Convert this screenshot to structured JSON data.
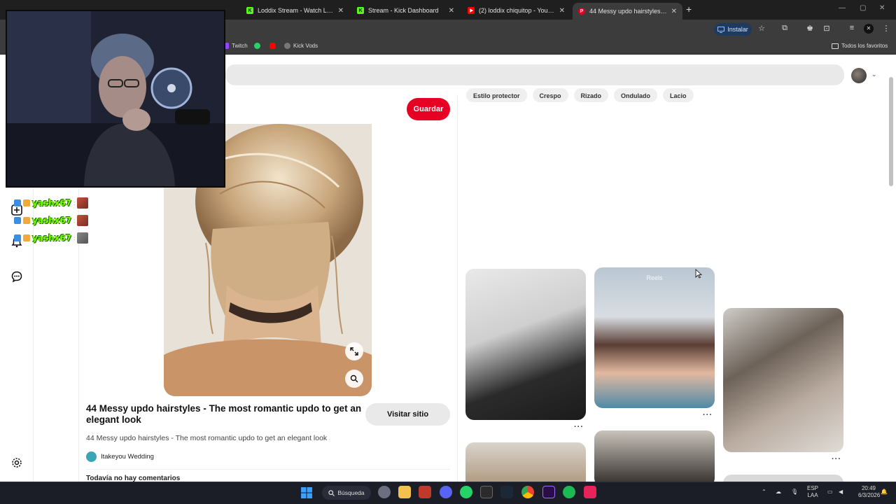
{
  "browser": {
    "tabs": [
      {
        "title": "Loddix Stream - Watch Live on",
        "icon": "kick-icon",
        "color": "#53fc18"
      },
      {
        "title": "Stream - Kick Dashboard",
        "icon": "kick-icon",
        "color": "#53fc18"
      },
      {
        "title": "(2) loddix chiquitop - YouTube",
        "icon": "youtube-icon",
        "color": "#ff0000"
      },
      {
        "title": "44 Messy updo hairstyles - The",
        "icon": "pinterest-icon",
        "color": "#e60023"
      }
    ],
    "install_label": "Instalar",
    "bookmarks": {
      "twitch": "Twitch",
      "kick_vods": "Kick Vods",
      "all_favorites": "Todos los favoritos"
    }
  },
  "filter_chips": [
    "Estilo protector",
    "Crespo",
    "Rizado",
    "Ondulado",
    "Lacio"
  ],
  "pin": {
    "save_label": "Guardar",
    "title": "44 Messy updo hairstyles - The most romantic updo to get an elegant look",
    "visit_label": "Visitar sitio",
    "description": "44 Messy updo hairstyles - The most romantic updo to get an elegant look",
    "author": "Itakeyou Wedding",
    "comments_heading": "Todavía no hay comentarios"
  },
  "grid": {
    "reels_label": "Reels",
    "more_label": "···"
  },
  "chat": {
    "messages": [
      {
        "user": "yashx67",
        "separator": ":"
      },
      {
        "user": "yashx67",
        "separator": ":"
      },
      {
        "user": "yashx67",
        "separator": ":"
      }
    ]
  },
  "taskbar": {
    "search_label": "Búsqueda",
    "language_top": "ESP",
    "language_bottom": "LAA",
    "time": "20:49",
    "date": "6/3/2026"
  },
  "colors": {
    "pinterest_red": "#e60023",
    "kick_green": "#53fc18",
    "chrome_dark": "#3c3c3c"
  }
}
